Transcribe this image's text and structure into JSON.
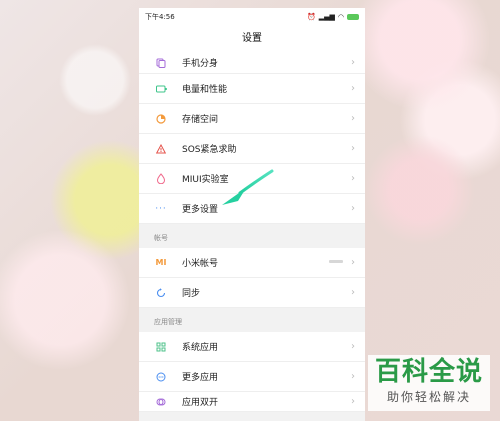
{
  "status_bar": {
    "time": "下午4:56",
    "battery": "■"
  },
  "title": "设置",
  "items_top": [
    {
      "label": "手机分身",
      "icon": "clone-icon",
      "color": "#a46bd8"
    },
    {
      "label": "电量和性能",
      "icon": "battery-icon",
      "color": "#3cc48a"
    },
    {
      "label": "存储空间",
      "icon": "storage-icon",
      "color": "#f39a3c"
    },
    {
      "label": "SOS紧急求助",
      "icon": "sos-icon",
      "color": "#e5534b"
    },
    {
      "label": "MIUI实验室",
      "icon": "lab-icon",
      "color": "#f06a8c"
    },
    {
      "label": "更多设置",
      "icon": "more-dots-icon",
      "color": "#4a8ef0"
    }
  ],
  "section_account": "帐号",
  "items_account": [
    {
      "label": "小米帐号",
      "icon": "mi-icon",
      "color": "#f39a3c",
      "value": ""
    },
    {
      "label": "同步",
      "icon": "sync-icon",
      "color": "#4a8ef0"
    }
  ],
  "section_apps": "应用管理",
  "items_apps": [
    {
      "label": "系统应用",
      "icon": "grid-icon",
      "color": "#4cc28a"
    },
    {
      "label": "更多应用",
      "icon": "more-apps-icon",
      "color": "#4a8ef0"
    },
    {
      "label": "应用双开",
      "icon": "dual-app-icon",
      "color": "#a46bd8"
    }
  ],
  "chevron": "›",
  "watermark": {
    "main": "百科全说",
    "sub": "助你轻松解决"
  }
}
